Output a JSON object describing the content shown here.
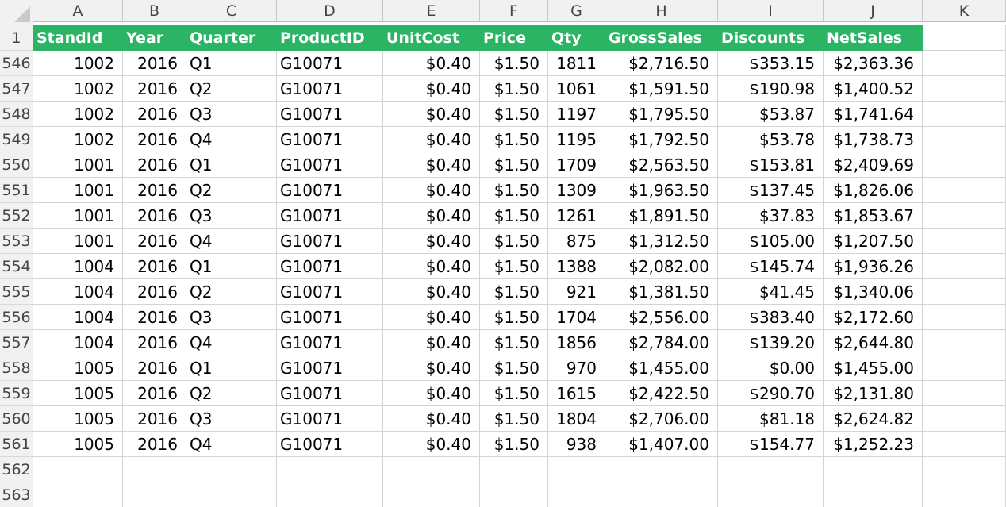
{
  "columns": [
    "A",
    "B",
    "C",
    "D",
    "E",
    "F",
    "G",
    "H",
    "I",
    "J",
    "K"
  ],
  "header": {
    "row_number": "1",
    "labels": [
      "StandId",
      "Year",
      "Quarter",
      "ProductID",
      "UnitCost",
      "Price",
      "Qty",
      "GrossSales",
      "Discounts",
      "NetSales",
      ""
    ]
  },
  "rows": [
    {
      "n": "546",
      "stand": "1002",
      "year": "2016",
      "quarter": "Q1",
      "product": "G10071",
      "unitcost": "$0.40",
      "price": "$1.50",
      "qty": "1811",
      "gross": "$2,716.50",
      "disc": "$353.15",
      "net": "$2,363.36"
    },
    {
      "n": "547",
      "stand": "1002",
      "year": "2016",
      "quarter": "Q2",
      "product": "G10071",
      "unitcost": "$0.40",
      "price": "$1.50",
      "qty": "1061",
      "gross": "$1,591.50",
      "disc": "$190.98",
      "net": "$1,400.52"
    },
    {
      "n": "548",
      "stand": "1002",
      "year": "2016",
      "quarter": "Q3",
      "product": "G10071",
      "unitcost": "$0.40",
      "price": "$1.50",
      "qty": "1197",
      "gross": "$1,795.50",
      "disc": "$53.87",
      "net": "$1,741.64"
    },
    {
      "n": "549",
      "stand": "1002",
      "year": "2016",
      "quarter": "Q4",
      "product": "G10071",
      "unitcost": "$0.40",
      "price": "$1.50",
      "qty": "1195",
      "gross": "$1,792.50",
      "disc": "$53.78",
      "net": "$1,738.73"
    },
    {
      "n": "550",
      "stand": "1001",
      "year": "2016",
      "quarter": "Q1",
      "product": "G10071",
      "unitcost": "$0.40",
      "price": "$1.50",
      "qty": "1709",
      "gross": "$2,563.50",
      "disc": "$153.81",
      "net": "$2,409.69"
    },
    {
      "n": "551",
      "stand": "1001",
      "year": "2016",
      "quarter": "Q2",
      "product": "G10071",
      "unitcost": "$0.40",
      "price": "$1.50",
      "qty": "1309",
      "gross": "$1,963.50",
      "disc": "$137.45",
      "net": "$1,826.06"
    },
    {
      "n": "552",
      "stand": "1001",
      "year": "2016",
      "quarter": "Q3",
      "product": "G10071",
      "unitcost": "$0.40",
      "price": "$1.50",
      "qty": "1261",
      "gross": "$1,891.50",
      "disc": "$37.83",
      "net": "$1,853.67"
    },
    {
      "n": "553",
      "stand": "1001",
      "year": "2016",
      "quarter": "Q4",
      "product": "G10071",
      "unitcost": "$0.40",
      "price": "$1.50",
      "qty": "875",
      "gross": "$1,312.50",
      "disc": "$105.00",
      "net": "$1,207.50"
    },
    {
      "n": "554",
      "stand": "1004",
      "year": "2016",
      "quarter": "Q1",
      "product": "G10071",
      "unitcost": "$0.40",
      "price": "$1.50",
      "qty": "1388",
      "gross": "$2,082.00",
      "disc": "$145.74",
      "net": "$1,936.26"
    },
    {
      "n": "555",
      "stand": "1004",
      "year": "2016",
      "quarter": "Q2",
      "product": "G10071",
      "unitcost": "$0.40",
      "price": "$1.50",
      "qty": "921",
      "gross": "$1,381.50",
      "disc": "$41.45",
      "net": "$1,340.06"
    },
    {
      "n": "556",
      "stand": "1004",
      "year": "2016",
      "quarter": "Q3",
      "product": "G10071",
      "unitcost": "$0.40",
      "price": "$1.50",
      "qty": "1704",
      "gross": "$2,556.00",
      "disc": "$383.40",
      "net": "$2,172.60"
    },
    {
      "n": "557",
      "stand": "1004",
      "year": "2016",
      "quarter": "Q4",
      "product": "G10071",
      "unitcost": "$0.40",
      "price": "$1.50",
      "qty": "1856",
      "gross": "$2,784.00",
      "disc": "$139.20",
      "net": "$2,644.80"
    },
    {
      "n": "558",
      "stand": "1005",
      "year": "2016",
      "quarter": "Q1",
      "product": "G10071",
      "unitcost": "$0.40",
      "price": "$1.50",
      "qty": "970",
      "gross": "$1,455.00",
      "disc": "$0.00",
      "net": "$1,455.00"
    },
    {
      "n": "559",
      "stand": "1005",
      "year": "2016",
      "quarter": "Q2",
      "product": "G10071",
      "unitcost": "$0.40",
      "price": "$1.50",
      "qty": "1615",
      "gross": "$2,422.50",
      "disc": "$290.70",
      "net": "$2,131.80"
    },
    {
      "n": "560",
      "stand": "1005",
      "year": "2016",
      "quarter": "Q3",
      "product": "G10071",
      "unitcost": "$0.40",
      "price": "$1.50",
      "qty": "1804",
      "gross": "$2,706.00",
      "disc": "$81.18",
      "net": "$2,624.82"
    },
    {
      "n": "561",
      "stand": "1005",
      "year": "2016",
      "quarter": "Q4",
      "product": "G10071",
      "unitcost": "$0.40",
      "price": "$1.50",
      "qty": "938",
      "gross": "$1,407.00",
      "disc": "$154.77",
      "net": "$1,252.23"
    }
  ],
  "empty_rows": [
    "562",
    "563"
  ],
  "colors": {
    "header_bg": "#2cb465",
    "header_text": "#ffffff"
  },
  "icons": {
    "corner": "select-all-triangle"
  }
}
